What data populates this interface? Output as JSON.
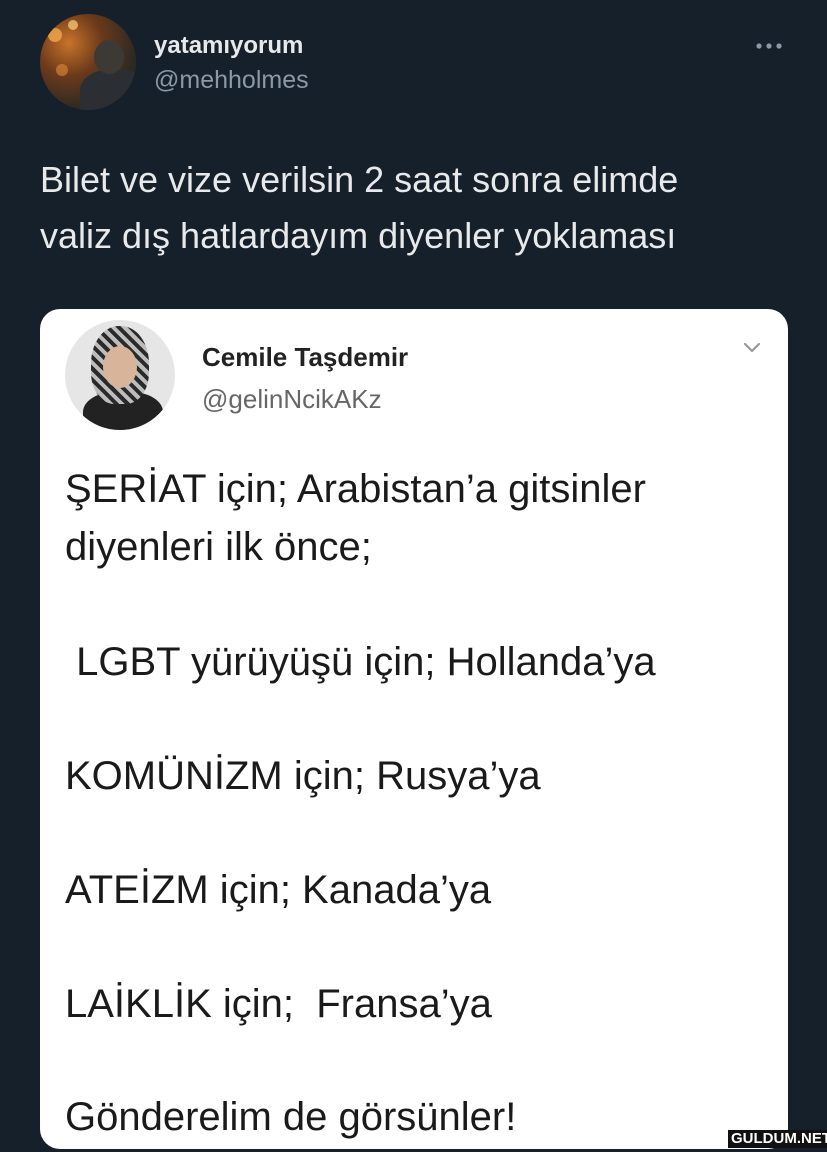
{
  "tweet": {
    "display_name": "yatamıyorum",
    "handle": "@mehholmes",
    "more_icon": "more-dots-icon",
    "text_line1": "Bilet ve vize verilsin 2 saat sonra elimde",
    "text_line2": "valiz dış hatlardayım diyenler yoklaması"
  },
  "embedded_tweet": {
    "display_name": "Cemile Taşdemir",
    "handle": "@gelinNcikAKz",
    "menu_icon": "chevron-down-icon",
    "lines": [
      "ŞERİAT için; Arabistan’a gitsinler",
      "diyenleri ilk önce;",
      " LGBT yürüyüşü için; Hollanda’ya",
      "KOMÜNİZM için; Rusya’ya",
      "ATEİZM için; Kanada’ya",
      "LAİKLİK için;  Fransa’ya",
      "Gönderelim de görsünler!"
    ]
  },
  "watermark": "GULDUM.NET",
  "colors": {
    "background": "#15202b",
    "primary_text": "#e7e9ea",
    "secondary_text": "#8b98a5",
    "card_background": "#ffffff"
  }
}
